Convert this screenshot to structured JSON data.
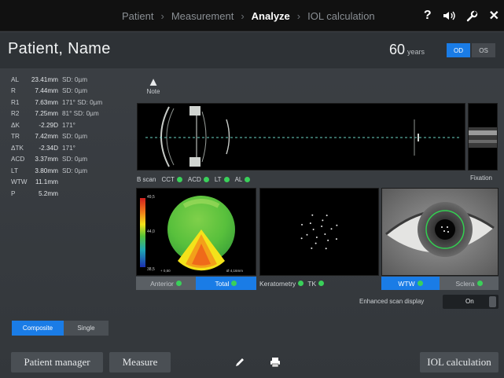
{
  "nav": {
    "crumbs": [
      "Patient",
      "Measurement",
      "Analyze",
      "IOL calculation"
    ],
    "active_index": 2,
    "separator": "›",
    "icons": [
      "help-icon",
      "speaker-icon",
      "wrench-icon",
      "close-icon"
    ],
    "help_glyph": "?",
    "close_glyph": "✕"
  },
  "header": {
    "patient_name": "Patient, Name",
    "age_value": "60",
    "age_unit": "years",
    "eye_od": "OD",
    "eye_os": "OS",
    "selected_eye": "OD"
  },
  "measurements": [
    {
      "key": "AL",
      "value": "23.41mm",
      "sd": "SD: 0µm"
    },
    {
      "key": "R",
      "value": "7.44mm",
      "sd": "SD: 0µm"
    },
    {
      "key": "R1",
      "value": "7.63mm",
      "sd": "171° SD: 0µm"
    },
    {
      "key": "R2",
      "value": "7.25mm",
      "sd": "81° SD: 0µm"
    },
    {
      "key": "ΔK",
      "value": "-2.29D",
      "sd": "171°"
    },
    {
      "key": "TR",
      "value": "7.42mm",
      "sd": "SD: 0µm"
    },
    {
      "key": "ΔTK",
      "value": "-2.34D",
      "sd": "171°"
    },
    {
      "key": "ACD",
      "value": "3.37mm",
      "sd": "SD: 0µm"
    },
    {
      "key": "LT",
      "value": "3.80mm",
      "sd": "SD: 0µm"
    },
    {
      "key": "WTW",
      "value": "11.1mm",
      "sd": ""
    },
    {
      "key": "P",
      "value": "5.2mm",
      "sd": ""
    }
  ],
  "note": {
    "glyph": "▲",
    "label": "Note"
  },
  "status": {
    "bscan_label": "B scan",
    "items": [
      "CCT",
      "ACD",
      "LT",
      "AL"
    ],
    "fixation_label": "Fixation",
    "ok_color": "#3ad05a"
  },
  "topography": {
    "scale_top": "49,5",
    "scale_mid": "44,0",
    "scale_bottom": "38,5",
    "corner_left": "+ 0,50",
    "corner_right": "Ø 4,16mm"
  },
  "tabs": {
    "anterior": "Anterior",
    "total": "Total",
    "keratometry": "Keratometry",
    "tk": "TK",
    "wtw": "WTW",
    "sclera": "Sclera"
  },
  "enhanced": {
    "label": "Enhanced scan display",
    "value": "On"
  },
  "mode": {
    "composite": "Composite",
    "single": "Single",
    "selected": "Composite"
  },
  "bottom": {
    "patient_manager": "Patient manager",
    "measure": "Measure",
    "iol_calc": "IOL calculation",
    "icons": [
      "pencil-icon",
      "printer-icon"
    ]
  },
  "colors": {
    "accent": "#1a7ce6",
    "ok": "#3ad05a",
    "topbar": "#111111"
  }
}
